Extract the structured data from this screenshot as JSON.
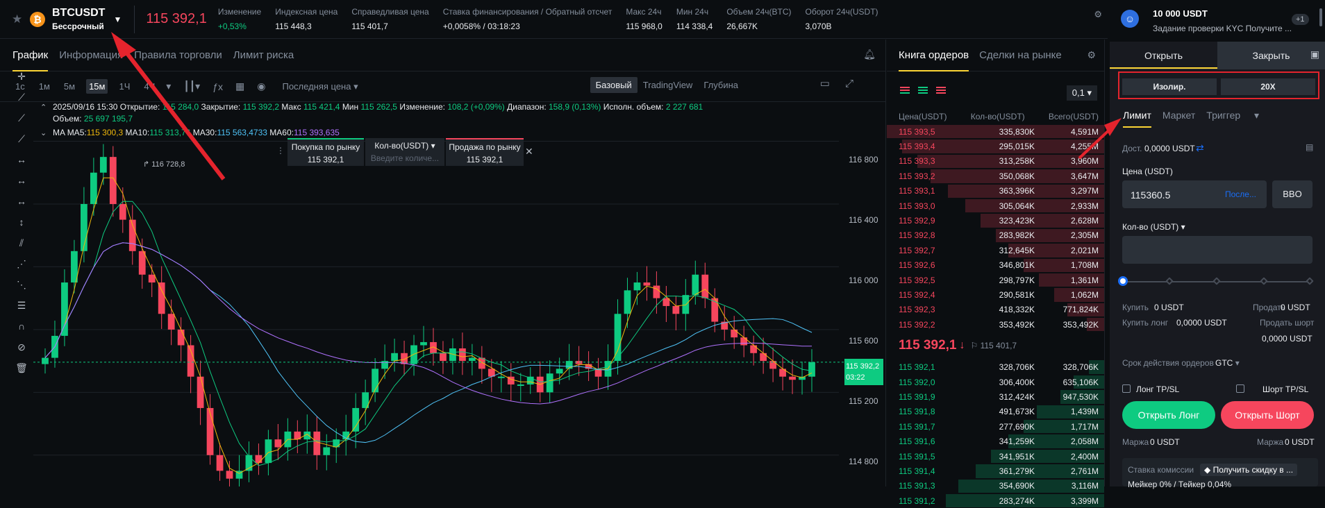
{
  "header": {
    "symbol": "BTCUSDT",
    "contract_type": "Бессрочный",
    "last_price": "115 392,1",
    "stats": [
      {
        "label": "Изменение",
        "value": "+0,53%",
        "color": "#0ecb81"
      },
      {
        "label": "Индексная цена",
        "value": "115 448,3"
      },
      {
        "label": "Справедливая цена",
        "value": "115 401,7"
      },
      {
        "label": "Ставка финансирования / Обратный отсчет",
        "value": "+0,0058% / 03:18:23"
      },
      {
        "label": "Макс 24ч",
        "value": "115 968,0"
      },
      {
        "label": "Мин 24ч",
        "value": "114 338,4"
      },
      {
        "label": "Объем 24ч(BTC)",
        "value": "26,667K"
      },
      {
        "label": "Оборот 24ч(USDT)",
        "value": "3,070B"
      }
    ]
  },
  "chart_panel": {
    "tabs": [
      "График",
      "Информация",
      "Правила торговли",
      "Лимит риска"
    ],
    "intervals": [
      "1с",
      "1м",
      "5м",
      "15м",
      "1Ч",
      "4Ч"
    ],
    "active_interval": "15м",
    "price_type": "Последняя цена",
    "views": [
      "Базовый",
      "TradingView",
      "Глубина"
    ],
    "active_view": "Базовый",
    "ohlc": {
      "date": "2025/09/16 15:30",
      "open_label": "Открытие:",
      "open": "115 284,0",
      "close_label": "Закрытие:",
      "close": "115 392,2",
      "high_label": "Макс",
      "high": "115 421,4",
      "low_label": "Мин",
      "low": "115 262,5",
      "change_label": "Изменение:",
      "change": "108,2 (+0,09%)",
      "range_label": "Диапазон:",
      "range": "158,9 (0,13%)",
      "exec_label": "Исполн. объем:",
      "exec": "2 227 681",
      "volume_label": "Объем:",
      "volume": "25 697 195,7"
    },
    "ma_line": {
      "label": "MA",
      "ma5": {
        "label": "MA5:",
        "value": "115 300,3",
        "color": "#f0b90b"
      },
      "ma10": {
        "label": "MA10:",
        "value": "115 313,76",
        "color": "#0ecb81"
      },
      "ma30": {
        "label": "MA30:",
        "value": "115 563,4733",
        "color": "#4fc3f7"
      },
      "ma60": {
        "label": "MA60:",
        "value": "115 393,635",
        "color": "#b072ff"
      }
    },
    "quick_order": {
      "buy_label": "Покупка по рынку",
      "buy_price": "115 392,1",
      "qty_label": "Кол-во(USDT)",
      "qty_placeholder": "Введите количе...",
      "sell_label": "Продажа по рынку",
      "sell_price": "115 392,1"
    },
    "peak_label": "116 728,8",
    "y_axis": [
      "116 800",
      "116 400",
      "116 000",
      "115 600",
      "115 200",
      "114 800"
    ],
    "price_tag": "115 392,2",
    "countdown": "03:22"
  },
  "chart_data": {
    "type": "candlestick",
    "y_axis_ticks": [
      116800,
      116400,
      116000,
      115600,
      115200,
      114800
    ],
    "last": 115392.2,
    "peak": 116728.8,
    "series_names": [
      "MA5",
      "MA10",
      "MA30",
      "MA60"
    ],
    "closes": [
      115420,
      115560,
      115900,
      116100,
      116400,
      116600,
      116700,
      116400,
      116300,
      116100,
      115950,
      115900,
      115700,
      115600,
      115500,
      115300,
      115100,
      114800,
      114700,
      114650,
      114700,
      114800,
      114750,
      114900,
      114850,
      114950,
      114900,
      114950,
      114800,
      114850,
      114900,
      114950,
      115100,
      115200,
      115350,
      115400,
      115450,
      115380,
      115500,
      115520,
      115450,
      115400,
      115480,
      115400,
      115420,
      115350,
      115300,
      115300,
      115250,
      115250,
      115300,
      115200,
      115320,
      115350,
      115400,
      115380,
      115350,
      115300,
      115400,
      115700,
      115850,
      115900,
      115880,
      115800,
      115750,
      115700,
      115820,
      115950,
      115800,
      115650,
      115600,
      115550,
      115500,
      115450,
      115400,
      115350,
      115300,
      115280,
      115300,
      115392
    ]
  },
  "orderbook": {
    "tabs": [
      "Книга ордеров",
      "Сделки на рынке"
    ],
    "tick": "0,1",
    "headers": [
      "Цена(USDT)",
      "Кол-во(USDT)",
      "Всего(USDT)"
    ],
    "asks": [
      {
        "p": "115 393,5",
        "q": "335,830K",
        "t": "4,591M",
        "d": 1.0
      },
      {
        "p": "115 393,4",
        "q": "295,015K",
        "t": "4,255M",
        "d": 0.93
      },
      {
        "p": "115 393,3",
        "q": "313,258K",
        "t": "3,960M",
        "d": 0.86
      },
      {
        "p": "115 393,2",
        "q": "350,068K",
        "t": "3,647M",
        "d": 0.8
      },
      {
        "p": "115 393,1",
        "q": "363,396K",
        "t": "3,297M",
        "d": 0.72
      },
      {
        "p": "115 393,0",
        "q": "305,064K",
        "t": "2,933M",
        "d": 0.64
      },
      {
        "p": "115 392,9",
        "q": "323,423K",
        "t": "2,628M",
        "d": 0.57
      },
      {
        "p": "115 392,8",
        "q": "283,982K",
        "t": "2,305M",
        "d": 0.5
      },
      {
        "p": "115 392,7",
        "q": "312,645K",
        "t": "2,021M",
        "d": 0.44
      },
      {
        "p": "115 392,6",
        "q": "346,801K",
        "t": "1,708M",
        "d": 0.37
      },
      {
        "p": "115 392,5",
        "q": "298,797K",
        "t": "1,361M",
        "d": 0.3
      },
      {
        "p": "115 392,4",
        "q": "290,581K",
        "t": "1,062M",
        "d": 0.23
      },
      {
        "p": "115 392,3",
        "q": "418,332K",
        "t": "771,824K",
        "d": 0.17
      },
      {
        "p": "115 392,2",
        "q": "353,492K",
        "t": "353,492K",
        "d": 0.08
      }
    ],
    "mid_price": "115 392,1",
    "mid_arrow": "↓",
    "mark_price": "115 401,7",
    "bids": [
      {
        "p": "115 392,1",
        "q": "328,706K",
        "t": "328,706K",
        "d": 0.07
      },
      {
        "p": "115 392,0",
        "q": "306,400K",
        "t": "635,106K",
        "d": 0.14
      },
      {
        "p": "115 391,9",
        "q": "312,424K",
        "t": "947,530K",
        "d": 0.2
      },
      {
        "p": "115 391,8",
        "q": "491,673K",
        "t": "1,439M",
        "d": 0.31
      },
      {
        "p": "115 391,7",
        "q": "277,690K",
        "t": "1,717M",
        "d": 0.37
      },
      {
        "p": "115 391,6",
        "q": "341,259K",
        "t": "2,058M",
        "d": 0.44
      },
      {
        "p": "115 391,5",
        "q": "341,951K",
        "t": "2,400M",
        "d": 0.52
      },
      {
        "p": "115 391,4",
        "q": "361,279K",
        "t": "2,761M",
        "d": 0.59
      },
      {
        "p": "115 391,3",
        "q": "354,690K",
        "t": "3,116M",
        "d": 0.67
      },
      {
        "p": "115 391,2",
        "q": "283,274K",
        "t": "3,399M",
        "d": 0.73
      }
    ]
  },
  "trade_panel": {
    "balance": "10 000 USDT",
    "kyc_task": "Задание проверки KYC Получите ...",
    "notif": "+1",
    "open_label": "Открыть",
    "close_label": "Закрыть",
    "margin_mode": "Изолир.",
    "leverage": "20X",
    "order_tabs": [
      "Лимит",
      "Маркет",
      "Триггер"
    ],
    "available_label": "Дост.",
    "available": "0,0000 USDT",
    "price_label": "Цена (USDT)",
    "price_value": "115360.5",
    "price_last": "После...",
    "bbo": "BBO",
    "qty_label": "Кол-во (USDT)",
    "buy_label": "Купить",
    "buy_val": "0 USDT",
    "sell_label": "Продать",
    "sell_val": "0 USDT",
    "buy_long_label": "Купить лонг",
    "buy_long_val": "0,0000 USDT",
    "sell_short_label": "Продать шорт",
    "sell_short_val": "0,0000 USDT",
    "tif_label": "Срок действия ордеров",
    "tif": "GTC",
    "long_tpsl": "Лонг TP/SL",
    "short_tpsl": "Шорт TP/SL",
    "open_long": "Открыть Лонг",
    "open_short": "Открыть Шорт",
    "margin_label": "Маржа",
    "margin_long": "0 USDT",
    "margin_short": "0 USDT",
    "fee_label": "Ставка комиссии",
    "promo": "Получить скидку в ...",
    "fee_rates": "Мейкер 0% / Тейкер 0,04%"
  }
}
